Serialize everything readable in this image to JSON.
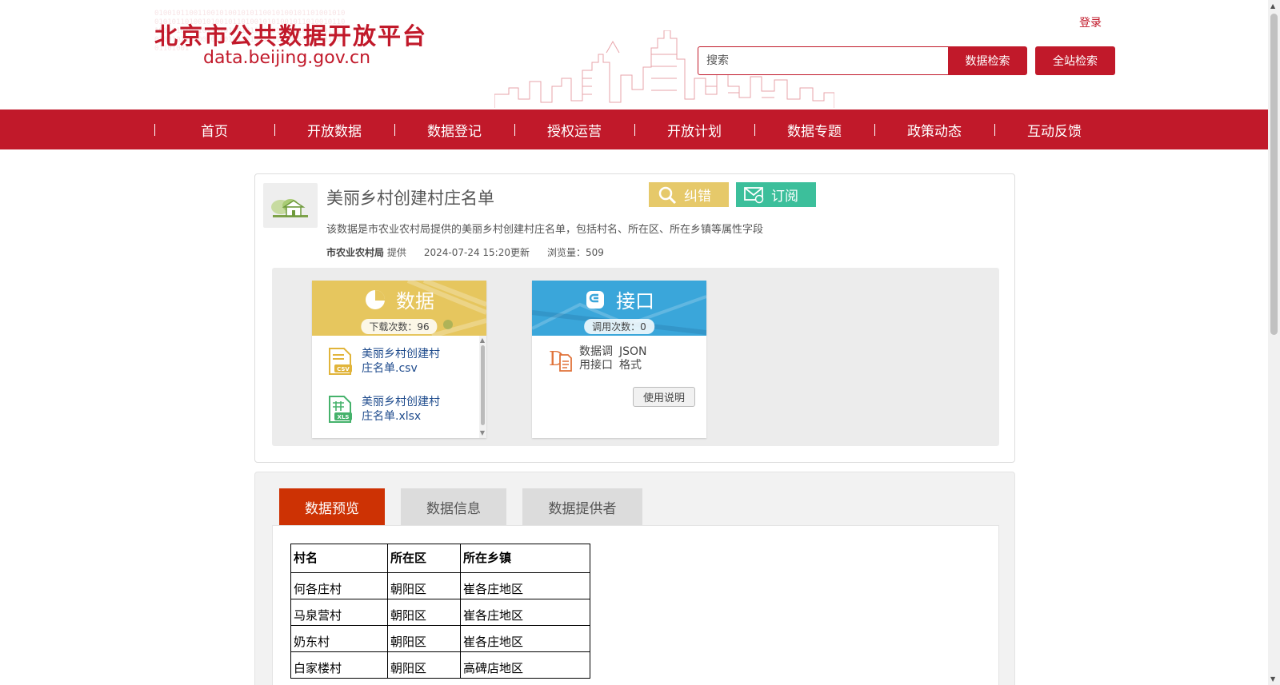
{
  "header": {
    "logo_title": "北京市公共数据开放平台",
    "logo_url": "data.beijing.gov.cn",
    "login_label": "登录",
    "search_placeholder": "搜索",
    "data_search_label": "数据检索",
    "site_search_label": "全站检索",
    "accent_color": "#c1192a"
  },
  "nav": {
    "items": [
      {
        "label": "首页"
      },
      {
        "label": "开放数据"
      },
      {
        "label": "数据登记"
      },
      {
        "label": "授权运营"
      },
      {
        "label": "开放计划"
      },
      {
        "label": "数据专题"
      },
      {
        "label": "政策动态"
      },
      {
        "label": "互动反馈"
      }
    ]
  },
  "dataset": {
    "title": "美丽乡村创建村庄名单",
    "correction_label": "纠错",
    "subscribe_label": "订阅",
    "description": "该数据是市农业农村局提供的美丽乡村创建村庄名单，包括村名、所在区、所在乡镇等属性字段",
    "provider": "市农业农村局",
    "provider_suffix": "提供",
    "updated": "2024-07-24 15:20更新",
    "views": "浏览量：509"
  },
  "resources": {
    "data": {
      "title": "数据",
      "count": "下载次数：96",
      "files": [
        {
          "name": "美丽乡村创建村庄名单.csv",
          "icon": "csv-file-icon"
        },
        {
          "name": "美丽乡村创建村庄名单.xlsx",
          "icon": "xls-file-icon"
        }
      ]
    },
    "api": {
      "title": "接口",
      "count": "调用次数：0",
      "desc_line1": "数据调",
      "desc_line2": "用接口",
      "format_line1": "JSON",
      "format_line2": "格式",
      "usage_label": "使用说明"
    }
  },
  "tabs": {
    "preview": "数据预览",
    "info": "数据信息",
    "provider": "数据提供者"
  },
  "preview_table": {
    "headers": [
      "村名",
      "所在区",
      "所在乡镇"
    ],
    "rows": [
      [
        "何各庄村",
        "朝阳区",
        "崔各庄地区"
      ],
      [
        "马泉营村",
        "朝阳区",
        "崔各庄地区"
      ],
      [
        "奶东村",
        "朝阳区",
        "崔各庄地区"
      ],
      [
        "白家楼村",
        "朝阳区",
        "高碑店地区"
      ]
    ]
  }
}
